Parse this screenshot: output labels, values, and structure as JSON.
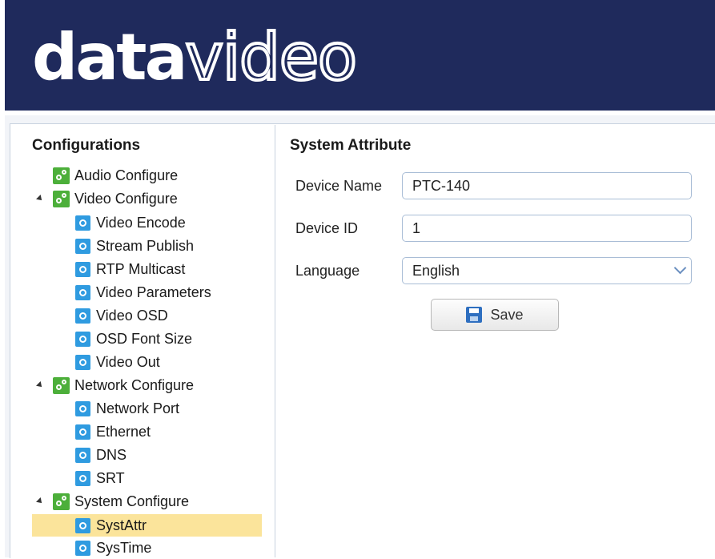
{
  "brand": {
    "logo_bold": "data",
    "logo_light": "video"
  },
  "sidebar": {
    "title": "Configurations",
    "items": [
      {
        "label": "Audio Configure"
      },
      {
        "label": "Video Configure"
      },
      {
        "label": "Video Encode"
      },
      {
        "label": "Stream Publish"
      },
      {
        "label": "RTP Multicast"
      },
      {
        "label": "Video Parameters"
      },
      {
        "label": "Video OSD"
      },
      {
        "label": "OSD Font Size"
      },
      {
        "label": "Video Out"
      },
      {
        "label": "Network Configure"
      },
      {
        "label": "Network Port"
      },
      {
        "label": "Ethernet"
      },
      {
        "label": "DNS"
      },
      {
        "label": "SRT"
      },
      {
        "label": "System Configure"
      },
      {
        "label": "SystAttr"
      },
      {
        "label": "SysTime"
      }
    ],
    "selected": "SystAttr"
  },
  "form": {
    "title": "System Attribute",
    "device_name_label": "Device Name",
    "device_name_value": "PTC-140",
    "device_id_label": "Device ID",
    "device_id_value": "1",
    "language_label": "Language",
    "language_value": "English",
    "save_label": "Save"
  }
}
